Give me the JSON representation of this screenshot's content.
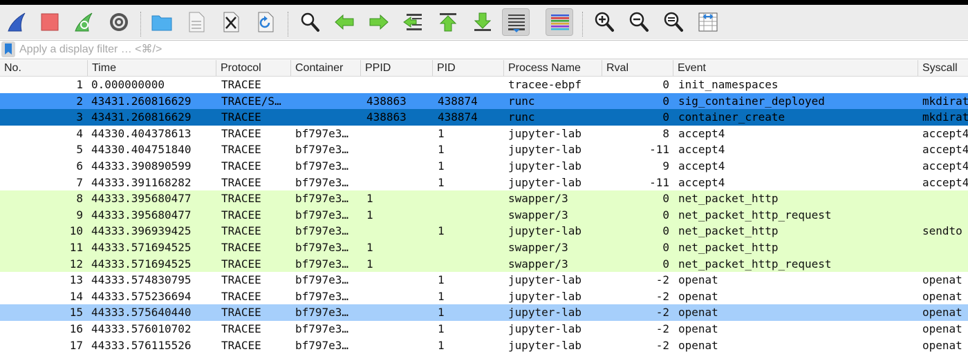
{
  "toolbar": {
    "buttons": [
      {
        "icon": "shark-fin-start-icon"
      },
      {
        "icon": "stop-square-icon"
      },
      {
        "icon": "shark-fin-restart-icon"
      },
      {
        "icon": "gear-icon"
      },
      {
        "icon": "folder-open-icon"
      },
      {
        "icon": "save-file-icon"
      },
      {
        "icon": "close-file-icon"
      },
      {
        "icon": "reload-file-icon"
      },
      {
        "icon": "search-icon"
      },
      {
        "icon": "arrow-left-icon"
      },
      {
        "icon": "arrow-right-icon"
      },
      {
        "icon": "go-to-packet-icon"
      },
      {
        "icon": "first-packet-icon"
      },
      {
        "icon": "last-packet-icon"
      },
      {
        "icon": "autoscroll-icon",
        "active": true
      },
      {
        "icon": "colorize-icon",
        "active": true
      },
      {
        "icon": "zoom-in-icon"
      },
      {
        "icon": "zoom-out-icon"
      },
      {
        "icon": "zoom-reset-icon"
      },
      {
        "icon": "resize-columns-icon"
      }
    ]
  },
  "filter": {
    "placeholder": "Apply a display filter … <⌘/>",
    "value": ""
  },
  "colors": {
    "selected_dark": "#0a6fbd",
    "selected": "#3f95f6",
    "highlight_blue": "#a6cffb",
    "green": "#e4ffc8",
    "header_bg": "#f4f4f4",
    "toolbar_bg": "#ececec"
  },
  "columns": [
    "No.",
    "Time",
    "Protocol",
    "Container",
    "PPID",
    "PID",
    "Process Name",
    "Rval",
    "Event",
    "Syscall"
  ],
  "rows": [
    {
      "no": "1",
      "time": "0.000000000",
      "protocol": "TRACEE",
      "container": "",
      "ppid": "",
      "pid": "",
      "process": "tracee-ebpf",
      "rval": "0",
      "event": "init_namespaces",
      "syscall": "",
      "style": "white"
    },
    {
      "no": "2",
      "time": "43431.260816629",
      "protocol": "TRACEE/S…",
      "container": "",
      "ppid": "438863",
      "pid": "438874",
      "process": "runc",
      "rval": "0",
      "event": "sig_container_deployed",
      "syscall": "mkdirat",
      "style": "sel-blue"
    },
    {
      "no": "3",
      "time": "43431.260816629",
      "protocol": "TRACEE",
      "container": "",
      "ppid": "438863",
      "pid": "438874",
      "process": "runc",
      "rval": "0",
      "event": "container_create",
      "syscall": "mkdirat",
      "style": "sel-dark"
    },
    {
      "no": "4",
      "time": "44330.404378613",
      "protocol": "TRACEE",
      "container": "bf797e3…",
      "ppid": "",
      "pid": "1",
      "process": "jupyter-lab",
      "rval": "8",
      "event": "accept4",
      "syscall": "accept4",
      "style": "white"
    },
    {
      "no": "5",
      "time": "44330.404751840",
      "protocol": "TRACEE",
      "container": "bf797e3…",
      "ppid": "",
      "pid": "1",
      "process": "jupyter-lab",
      "rval": "-11",
      "event": "accept4",
      "syscall": "accept4",
      "style": "white"
    },
    {
      "no": "6",
      "time": "44333.390890599",
      "protocol": "TRACEE",
      "container": "bf797e3…",
      "ppid": "",
      "pid": "1",
      "process": "jupyter-lab",
      "rval": "9",
      "event": "accept4",
      "syscall": "accept4",
      "style": "white"
    },
    {
      "no": "7",
      "time": "44333.391168282",
      "protocol": "TRACEE",
      "container": "bf797e3…",
      "ppid": "",
      "pid": "1",
      "process": "jupyter-lab",
      "rval": "-11",
      "event": "accept4",
      "syscall": "accept4",
      "style": "white"
    },
    {
      "no": "8",
      "time": "44333.395680477",
      "protocol": "TRACEE",
      "container": "bf797e3…",
      "ppid": "1",
      "pid": "",
      "process": "swapper/3",
      "rval": "0",
      "event": "net_packet_http",
      "syscall": "",
      "style": "green"
    },
    {
      "no": "9",
      "time": "44333.395680477",
      "protocol": "TRACEE",
      "container": "bf797e3…",
      "ppid": "1",
      "pid": "",
      "process": "swapper/3",
      "rval": "0",
      "event": "net_packet_http_request",
      "syscall": "",
      "style": "green"
    },
    {
      "no": "10",
      "time": "44333.396939425",
      "protocol": "TRACEE",
      "container": "bf797e3…",
      "ppid": "",
      "pid": "1",
      "process": "jupyter-lab",
      "rval": "0",
      "event": "net_packet_http",
      "syscall": "sendto",
      "style": "green"
    },
    {
      "no": "11",
      "time": "44333.571694525",
      "protocol": "TRACEE",
      "container": "bf797e3…",
      "ppid": "1",
      "pid": "",
      "process": "swapper/3",
      "rval": "0",
      "event": "net_packet_http",
      "syscall": "",
      "style": "green"
    },
    {
      "no": "12",
      "time": "44333.571694525",
      "protocol": "TRACEE",
      "container": "bf797e3…",
      "ppid": "1",
      "pid": "",
      "process": "swapper/3",
      "rval": "0",
      "event": "net_packet_http_request",
      "syscall": "",
      "style": "green"
    },
    {
      "no": "13",
      "time": "44333.574830795",
      "protocol": "TRACEE",
      "container": "bf797e3…",
      "ppid": "",
      "pid": "1",
      "process": "jupyter-lab",
      "rval": "-2",
      "event": "openat",
      "syscall": "openat",
      "style": "white"
    },
    {
      "no": "14",
      "time": "44333.575236694",
      "protocol": "TRACEE",
      "container": "bf797e3…",
      "ppid": "",
      "pid": "1",
      "process": "jupyter-lab",
      "rval": "-2",
      "event": "openat",
      "syscall": "openat",
      "style": "white"
    },
    {
      "no": "15",
      "time": "44333.575640440",
      "protocol": "TRACEE",
      "container": "bf797e3…",
      "ppid": "",
      "pid": "1",
      "process": "jupyter-lab",
      "rval": "-2",
      "event": "openat",
      "syscall": "openat",
      "style": "light-blue"
    },
    {
      "no": "16",
      "time": "44333.576010702",
      "protocol": "TRACEE",
      "container": "bf797e3…",
      "ppid": "",
      "pid": "1",
      "process": "jupyter-lab",
      "rval": "-2",
      "event": "openat",
      "syscall": "openat",
      "style": "white"
    },
    {
      "no": "17",
      "time": "44333.576115526",
      "protocol": "TRACEE",
      "container": "bf797e3…",
      "ppid": "",
      "pid": "1",
      "process": "jupyter-lab",
      "rval": "-2",
      "event": "openat",
      "syscall": "openat",
      "style": "white"
    }
  ]
}
